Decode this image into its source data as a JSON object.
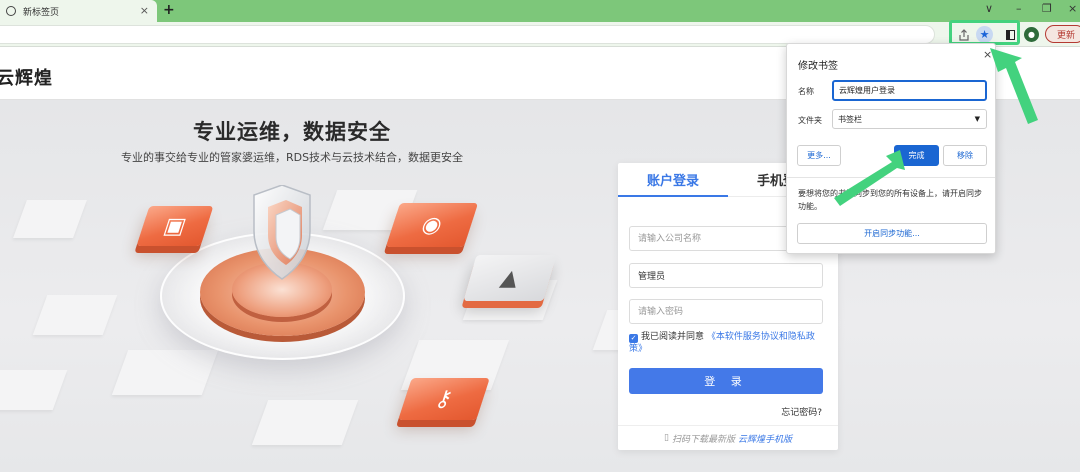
{
  "browser": {
    "tab_title": "新标签页",
    "tab_close": "×",
    "new_tab": "+",
    "window_controls": [
      "∨",
      "–",
      "❐",
      "×"
    ],
    "update_label": "更新"
  },
  "site": {
    "logo_text": "云辉煌"
  },
  "hero": {
    "title": "专业运维，数据安全",
    "subtitle": "专业的事交给专业的管家婆运维，RDS技术与云技术结合，数据更安全"
  },
  "login": {
    "tab_account": "账户登录",
    "tab_phone": "手机登录",
    "company_placeholder": "请输入公司名称",
    "username_value": "管理员",
    "password_placeholder": "请输入密码",
    "agree_text": "我已阅读并同意",
    "agree_link": "《本软件服务协议和隐私政策》",
    "agree_checked": true,
    "login_button": "登 录",
    "forgot": "忘记密码?",
    "footer_text": "扫码下载最新版",
    "footer_app": "云辉煌手机版"
  },
  "bookmark_popup": {
    "title": "修改书签",
    "close": "×",
    "name_label": "名称",
    "name_value": "云辉煌用户登录",
    "folder_label": "文件夹",
    "folder_value": "书签栏",
    "more_button": "更多...",
    "done_button": "完成",
    "remove_button": "移除",
    "sync_text": "要想将您的书签同步到您的所有设备上，请开启同步功能。",
    "sync_button": "开启同步功能..."
  },
  "colors": {
    "tab_strip": "#7dc77a",
    "accent_blue": "#4479e8",
    "highlight_green": "#43d27e",
    "hero_orange": "#ee6b42"
  }
}
